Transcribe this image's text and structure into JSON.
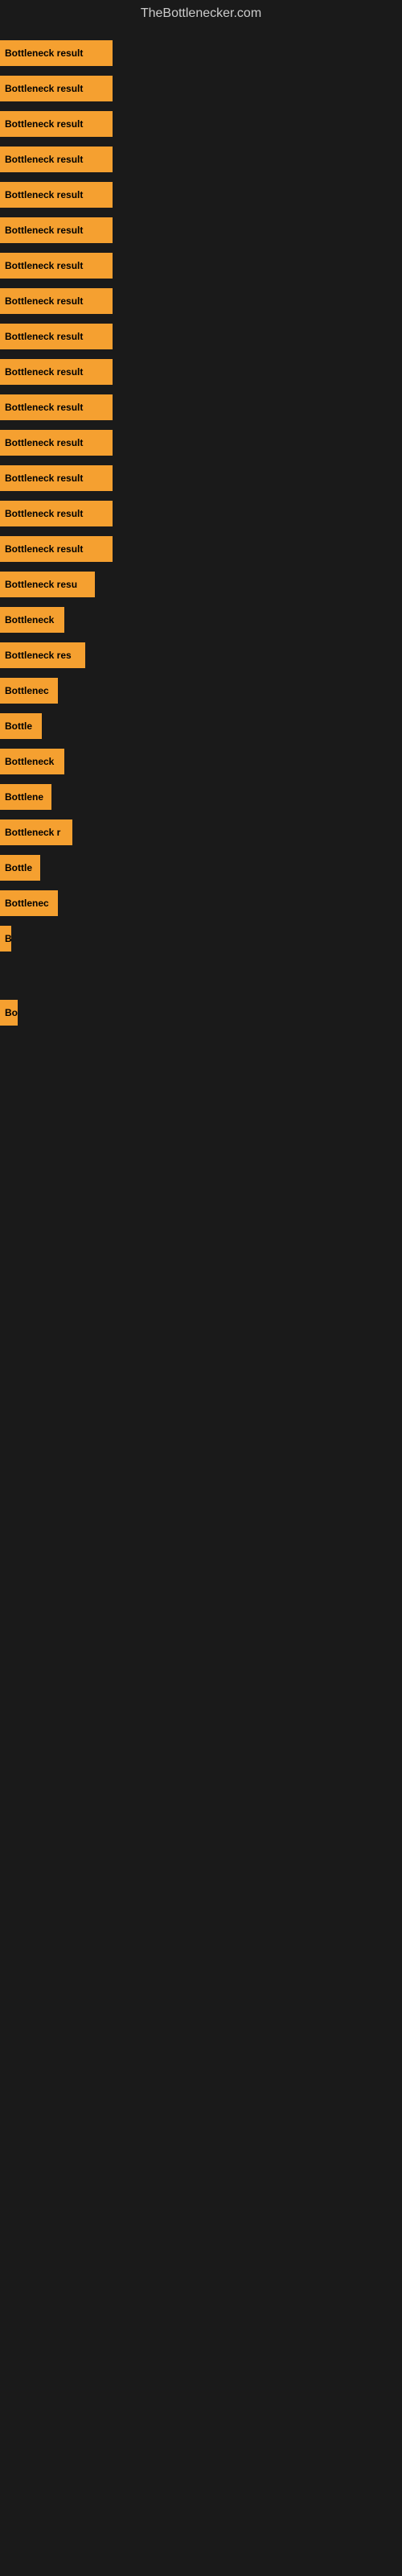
{
  "site": {
    "title": "TheBottlenecker.com"
  },
  "bars": [
    {
      "id": 1,
      "label": "Bottleneck result",
      "width": 140
    },
    {
      "id": 2,
      "label": "Bottleneck result",
      "width": 140
    },
    {
      "id": 3,
      "label": "Bottleneck result",
      "width": 140
    },
    {
      "id": 4,
      "label": "Bottleneck result",
      "width": 140
    },
    {
      "id": 5,
      "label": "Bottleneck result",
      "width": 140
    },
    {
      "id": 6,
      "label": "Bottleneck result",
      "width": 140
    },
    {
      "id": 7,
      "label": "Bottleneck result",
      "width": 140
    },
    {
      "id": 8,
      "label": "Bottleneck result",
      "width": 140
    },
    {
      "id": 9,
      "label": "Bottleneck result",
      "width": 140
    },
    {
      "id": 10,
      "label": "Bottleneck result",
      "width": 140
    },
    {
      "id": 11,
      "label": "Bottleneck result",
      "width": 140
    },
    {
      "id": 12,
      "label": "Bottleneck result",
      "width": 140
    },
    {
      "id": 13,
      "label": "Bottleneck result",
      "width": 140
    },
    {
      "id": 14,
      "label": "Bottleneck result",
      "width": 140
    },
    {
      "id": 15,
      "label": "Bottleneck result",
      "width": 140
    },
    {
      "id": 16,
      "label": "Bottleneck resu",
      "width": 118
    },
    {
      "id": 17,
      "label": "Bottleneck",
      "width": 80
    },
    {
      "id": 18,
      "label": "Bottleneck res",
      "width": 106
    },
    {
      "id": 19,
      "label": "Bottlenec",
      "width": 72
    },
    {
      "id": 20,
      "label": "Bottle",
      "width": 52
    },
    {
      "id": 21,
      "label": "Bottleneck",
      "width": 80
    },
    {
      "id": 22,
      "label": "Bottlene",
      "width": 64
    },
    {
      "id": 23,
      "label": "Bottleneck r",
      "width": 90
    },
    {
      "id": 24,
      "label": "Bottle",
      "width": 50
    },
    {
      "id": 25,
      "label": "Bottlenec",
      "width": 72
    },
    {
      "id": 26,
      "label": "B",
      "width": 14
    },
    {
      "id": 27,
      "label": "",
      "width": 0
    },
    {
      "id": 28,
      "label": "",
      "width": 0
    },
    {
      "id": 29,
      "label": "",
      "width": 0
    },
    {
      "id": 30,
      "label": "",
      "width": 0
    },
    {
      "id": 31,
      "label": "Bo",
      "width": 22
    },
    {
      "id": 32,
      "label": "",
      "width": 0
    },
    {
      "id": 33,
      "label": "",
      "width": 0
    },
    {
      "id": 34,
      "label": "",
      "width": 0
    },
    {
      "id": 35,
      "label": "",
      "width": 0
    },
    {
      "id": 36,
      "label": "",
      "width": 0
    }
  ]
}
